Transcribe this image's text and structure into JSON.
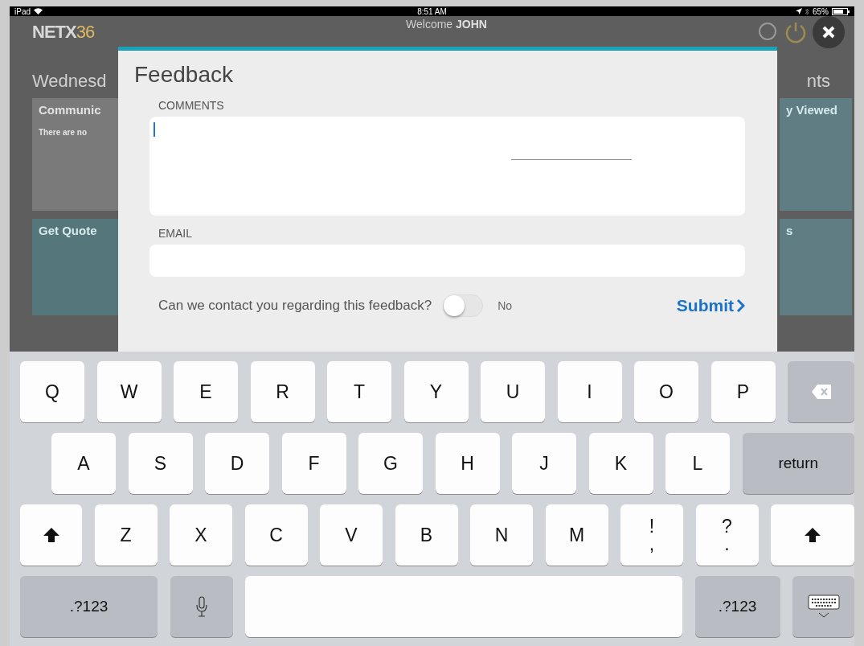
{
  "status_bar": {
    "carrier": "iPad",
    "time": "8:51 AM",
    "battery": "65%"
  },
  "dashboard": {
    "logo": {
      "text": "NETX",
      "accent": "36"
    },
    "welcome": "Welcome",
    "user": "JOHN",
    "date": "Wednesd",
    "right_heading": "nts",
    "left_tiles": [
      {
        "title": "Communic",
        "text": "There are no",
        "kind": "plain"
      },
      {
        "title": "Get Quote",
        "kind": "chart"
      }
    ],
    "right_tiles": [
      {
        "title": "y Viewed",
        "kind": "people"
      },
      {
        "title": "s",
        "kind": "plain"
      }
    ]
  },
  "modal": {
    "title": "Feedback",
    "comments_label": "COMMENTS",
    "email_label": "EMAIL",
    "contact_question": "Can we contact you regarding this feedback?",
    "contact_toggle": {
      "on": false
    },
    "toggle_label": "No",
    "submit": "Submit"
  },
  "keyboard": {
    "rows": [
      {
        "keys": [
          {
            "kind": "letter",
            "label": "Q"
          },
          {
            "kind": "letter",
            "label": "W"
          },
          {
            "kind": "letter",
            "label": "E"
          },
          {
            "kind": "letter",
            "label": "R"
          },
          {
            "kind": "letter",
            "label": "T"
          },
          {
            "kind": "letter",
            "label": "Y"
          },
          {
            "kind": "letter",
            "label": "U"
          },
          {
            "kind": "letter",
            "label": "I"
          },
          {
            "kind": "letter",
            "label": "O"
          },
          {
            "kind": "letter",
            "label": "P"
          },
          {
            "kind": "delete"
          }
        ]
      },
      {
        "keys": [
          {
            "kind": "letter",
            "label": "A"
          },
          {
            "kind": "letter",
            "label": "S"
          },
          {
            "kind": "letter",
            "label": "D"
          },
          {
            "kind": "letter",
            "label": "F"
          },
          {
            "kind": "letter",
            "label": "G"
          },
          {
            "kind": "letter",
            "label": "H"
          },
          {
            "kind": "letter",
            "label": "J"
          },
          {
            "kind": "letter",
            "label": "K"
          },
          {
            "kind": "letter",
            "label": "L"
          },
          {
            "kind": "return",
            "label": "return"
          }
        ]
      },
      {
        "keys": [
          {
            "kind": "shift"
          },
          {
            "kind": "letter",
            "label": "Z"
          },
          {
            "kind": "letter",
            "label": "X"
          },
          {
            "kind": "letter",
            "label": "C"
          },
          {
            "kind": "letter",
            "label": "V"
          },
          {
            "kind": "letter",
            "label": "B"
          },
          {
            "kind": "letter",
            "label": "N"
          },
          {
            "kind": "letter",
            "label": "M"
          },
          {
            "kind": "punct",
            "top": "!",
            "bottom": ","
          },
          {
            "kind": "punct",
            "top": "?",
            "bottom": "."
          },
          {
            "kind": "shift"
          }
        ]
      },
      {
        "keys": [
          {
            "kind": "numbers",
            "label": ".?123"
          },
          {
            "kind": "mic"
          },
          {
            "kind": "space"
          },
          {
            "kind": "numbers2",
            "label": ".?123"
          },
          {
            "kind": "hide"
          }
        ]
      }
    ]
  }
}
